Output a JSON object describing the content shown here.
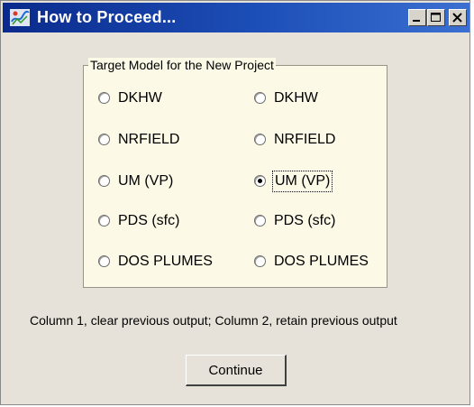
{
  "window": {
    "title": "How to Proceed...",
    "icon": "app-icon",
    "controls": [
      "minimize-icon",
      "maximize-icon",
      "close-icon"
    ]
  },
  "group": {
    "legend": "Target Model for the New Project",
    "column1": [
      {
        "label": "DKHW",
        "checked": false
      },
      {
        "label": "NRFIELD",
        "checked": false
      },
      {
        "label": "UM (VP)",
        "checked": false
      },
      {
        "label": "PDS (sfc)",
        "checked": false
      },
      {
        "label": "DOS PLUMES",
        "checked": false
      }
    ],
    "column2": [
      {
        "label": "DKHW",
        "checked": false
      },
      {
        "label": "NRFIELD",
        "checked": false
      },
      {
        "label": "UM (VP)",
        "checked": true
      },
      {
        "label": "PDS (sfc)",
        "checked": false
      },
      {
        "label": "DOS PLUMES",
        "checked": false
      }
    ]
  },
  "note": "Column 1, clear previous output; Column 2, retain previous output",
  "continue_label": "Continue",
  "colors": {
    "titlebar": "#0a2a8c",
    "dialog_bg": "#e7e2d9",
    "group_bg": "#fcf9e6"
  }
}
